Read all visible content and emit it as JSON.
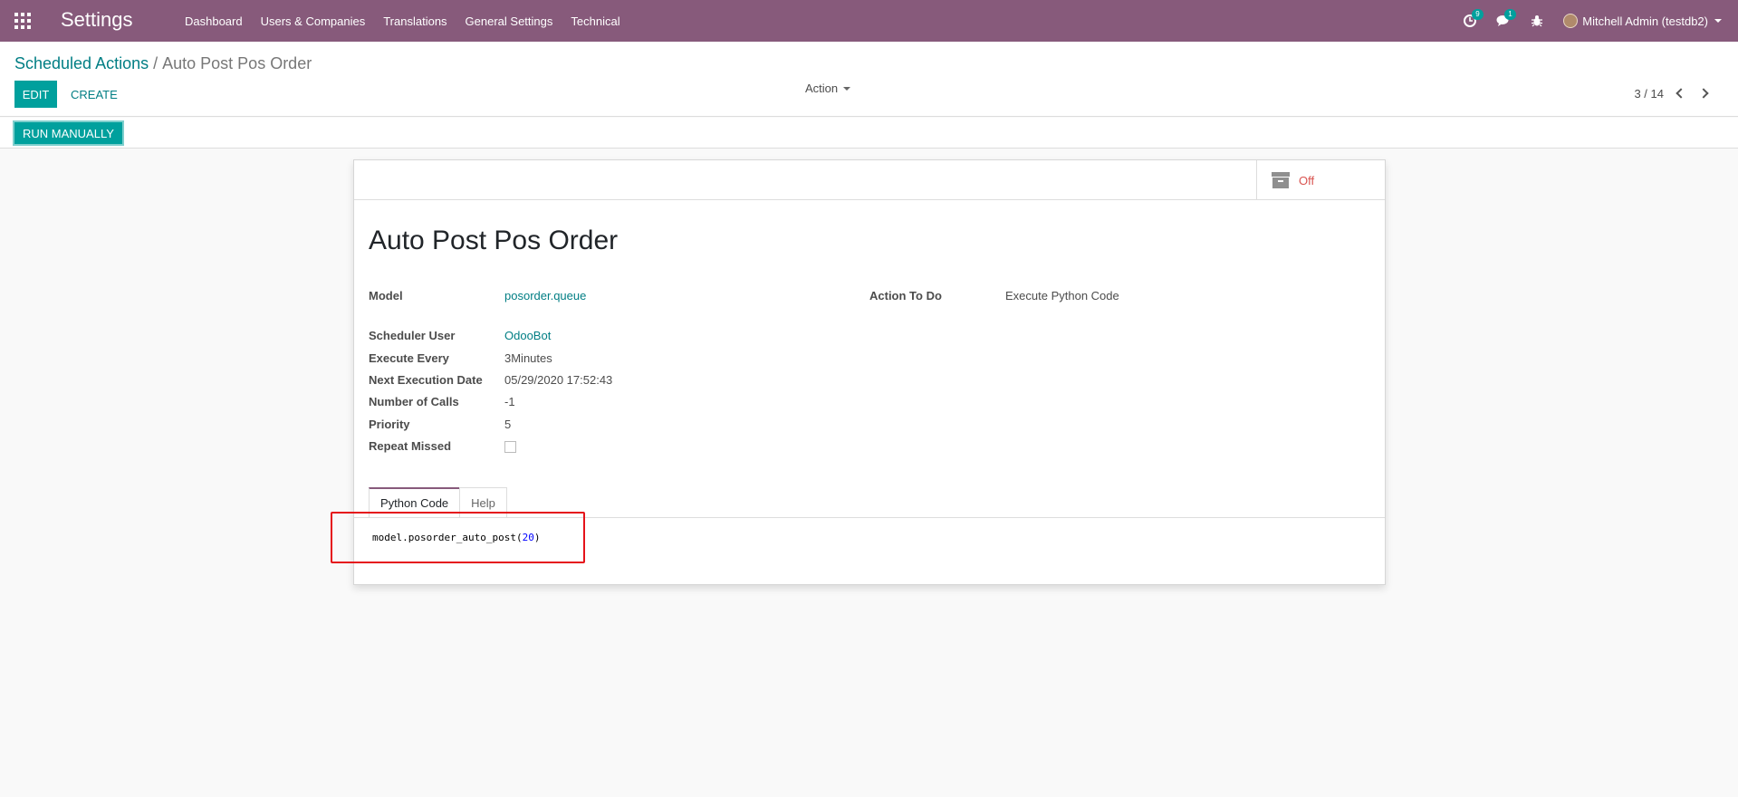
{
  "navbar": {
    "brand": "Settings",
    "menu": [
      "Dashboard",
      "Users & Companies",
      "Translations",
      "General Settings",
      "Technical"
    ],
    "activity_count": "9",
    "message_count": "1",
    "user_name": "Mitchell Admin (testdb2)"
  },
  "control_panel": {
    "breadcrumb_parent": "Scheduled Actions",
    "breadcrumb_separator": "/",
    "breadcrumb_current": "Auto Post Pos Order",
    "edit_label": "EDIT",
    "create_label": "CREATE",
    "action_label": "Action",
    "pager_value": "3 / 14"
  },
  "statusbar": {
    "run_manually_label": "RUN MANUALLY"
  },
  "form": {
    "archive_label": "Off",
    "title": "Auto Post Pos Order",
    "fields": {
      "model": {
        "label": "Model",
        "value": "posorder.queue"
      },
      "action_to_do": {
        "label": "Action To Do",
        "value": "Execute Python Code"
      },
      "scheduler_user": {
        "label": "Scheduler User",
        "value": "OdooBot"
      },
      "execute_every": {
        "label": "Execute Every",
        "value": "3Minutes"
      },
      "next_execution": {
        "label": "Next Execution Date",
        "value": "05/29/2020 17:52:43"
      },
      "number_of_calls": {
        "label": "Number of Calls",
        "value": "-1"
      },
      "priority": {
        "label": "Priority",
        "value": "5"
      },
      "repeat_missed": {
        "label": "Repeat Missed",
        "checked": false
      }
    },
    "tabs": [
      "Python Code",
      "Help"
    ],
    "code_text": "model.posorder_auto_post(",
    "code_number": "20",
    "code_close": ")"
  },
  "colors": {
    "brand_purple": "#875a7b",
    "primary_teal": "#00a09d",
    "link_teal": "#017e84",
    "highlight_red": "#e5131a",
    "archive_off_red": "#d9534f"
  }
}
